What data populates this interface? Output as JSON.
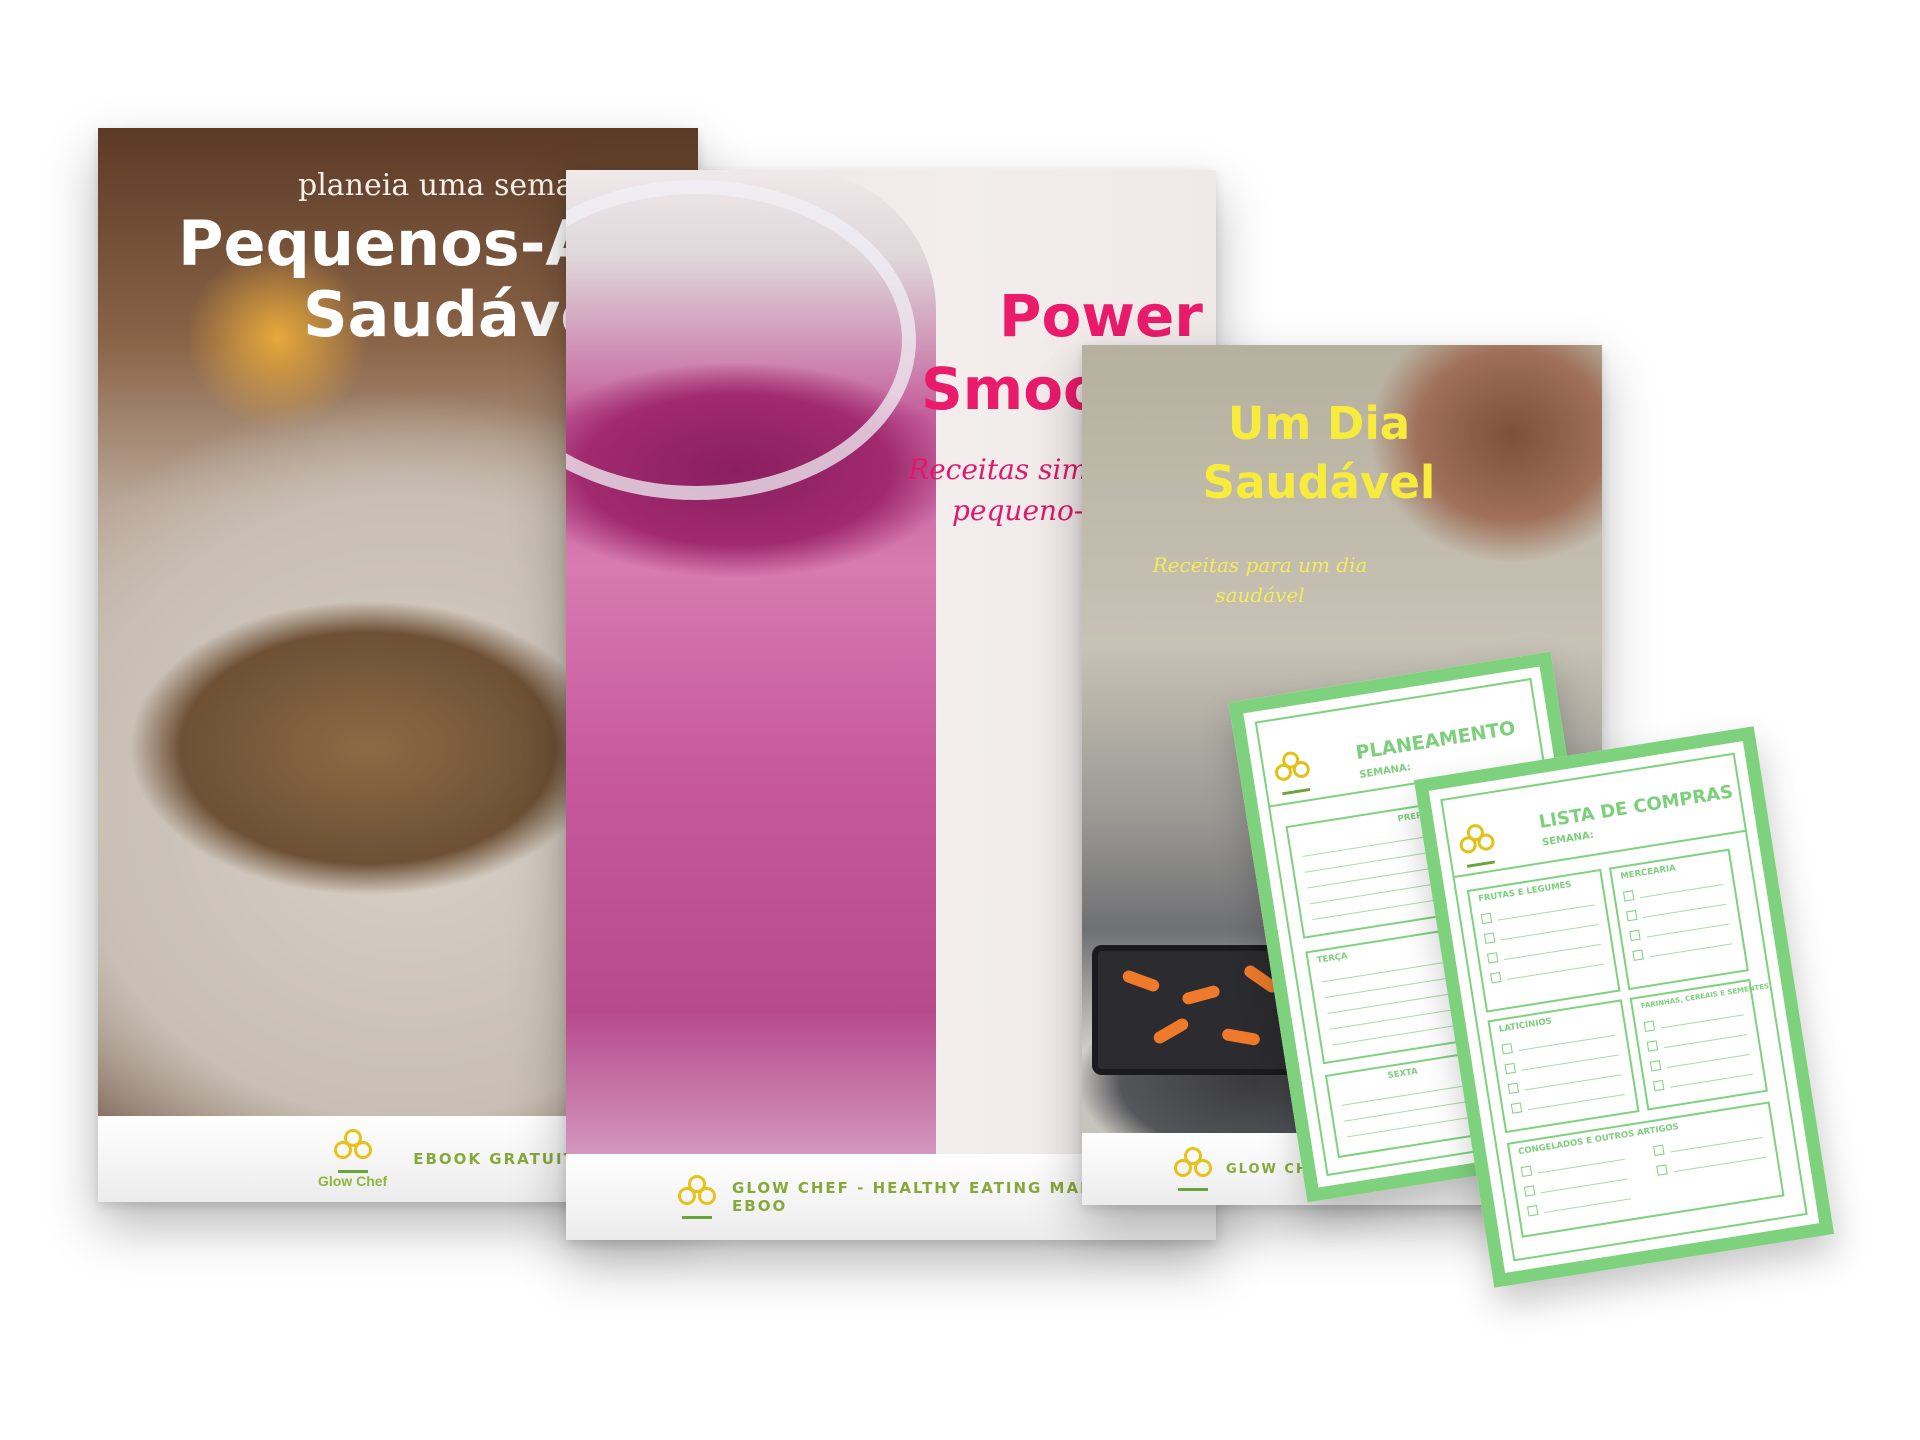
{
  "book1": {
    "subtitle": "planeia uma semana d",
    "title_line1": "Pequenos-Alm",
    "title_line2": "Saudáveis",
    "logo_text": "Glow Chef",
    "band_text": "EBOOK GRATUITO"
  },
  "book2": {
    "title_line1": "Power",
    "title_line2": "Smoot",
    "subtitle_line1": "Receitas simpl",
    "subtitle_line2": "pequeno-a",
    "band_text": "GLOW CHEF - HEALTHY EATING MADE EASY I EBOO"
  },
  "book3": {
    "title_line1": "Um Dia",
    "title_line2": "Saudável",
    "subtitle_line1": "Receitas para um dia",
    "subtitle_line2": "saudável",
    "band_text": "GLOW CHEF - HEALTHY EATIN"
  },
  "sheet1": {
    "title": "PLANEAMENTO",
    "semana": "SEMANA:",
    "labels": [
      "PREPARA",
      "TERÇA",
      "SEXTA"
    ]
  },
  "sheet2": {
    "title": "LISTA DE COMPRAS",
    "semana": "SEMANA:",
    "sections": [
      "FRUTAS E LEGUMES",
      "MERCEARIA",
      "FARINHAS, CEREAIS E SEMENTES",
      "LATICÍNIOS",
      "CONGELADOS E OUTROS ARTIGOS"
    ]
  },
  "colors": {
    "accent_green": "#7ed27d",
    "smoothie_pink": "#ea1b6b",
    "title_yellow": "#f7ec3b",
    "logo_yellow": "#e6c21a"
  }
}
